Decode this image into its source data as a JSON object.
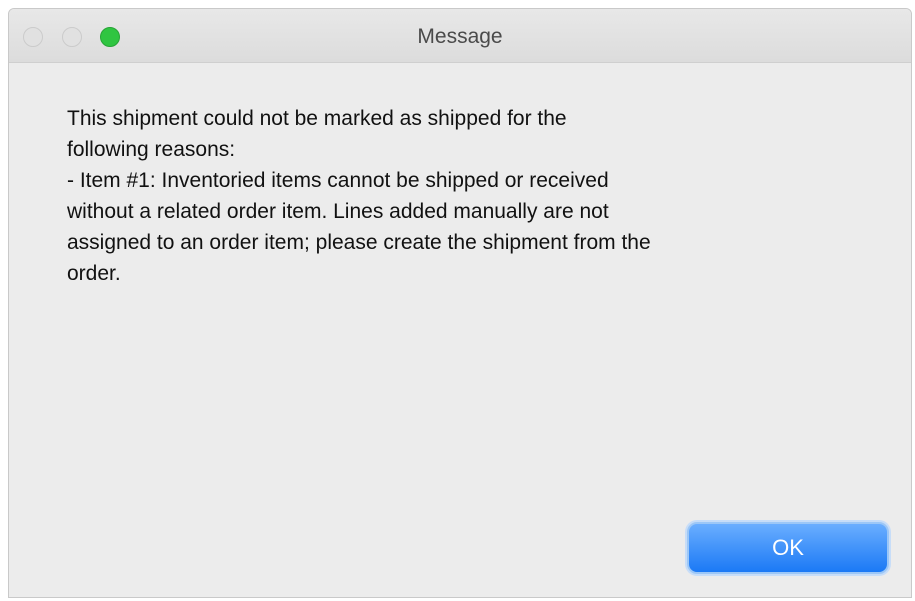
{
  "window": {
    "title": "Message"
  },
  "dialog": {
    "message": "This shipment could not be marked as shipped for the\nfollowing reasons:\n- Item #1: Inventoried items cannot be shipped or received\nwithout a related order item. Lines added manually are not\nassigned to an order item; please create the shipment from the\norder.",
    "ok_label": "OK"
  },
  "colors": {
    "accent": "#1b79f5",
    "zoom_button": "#2fc541",
    "window_background": "#ececec"
  }
}
